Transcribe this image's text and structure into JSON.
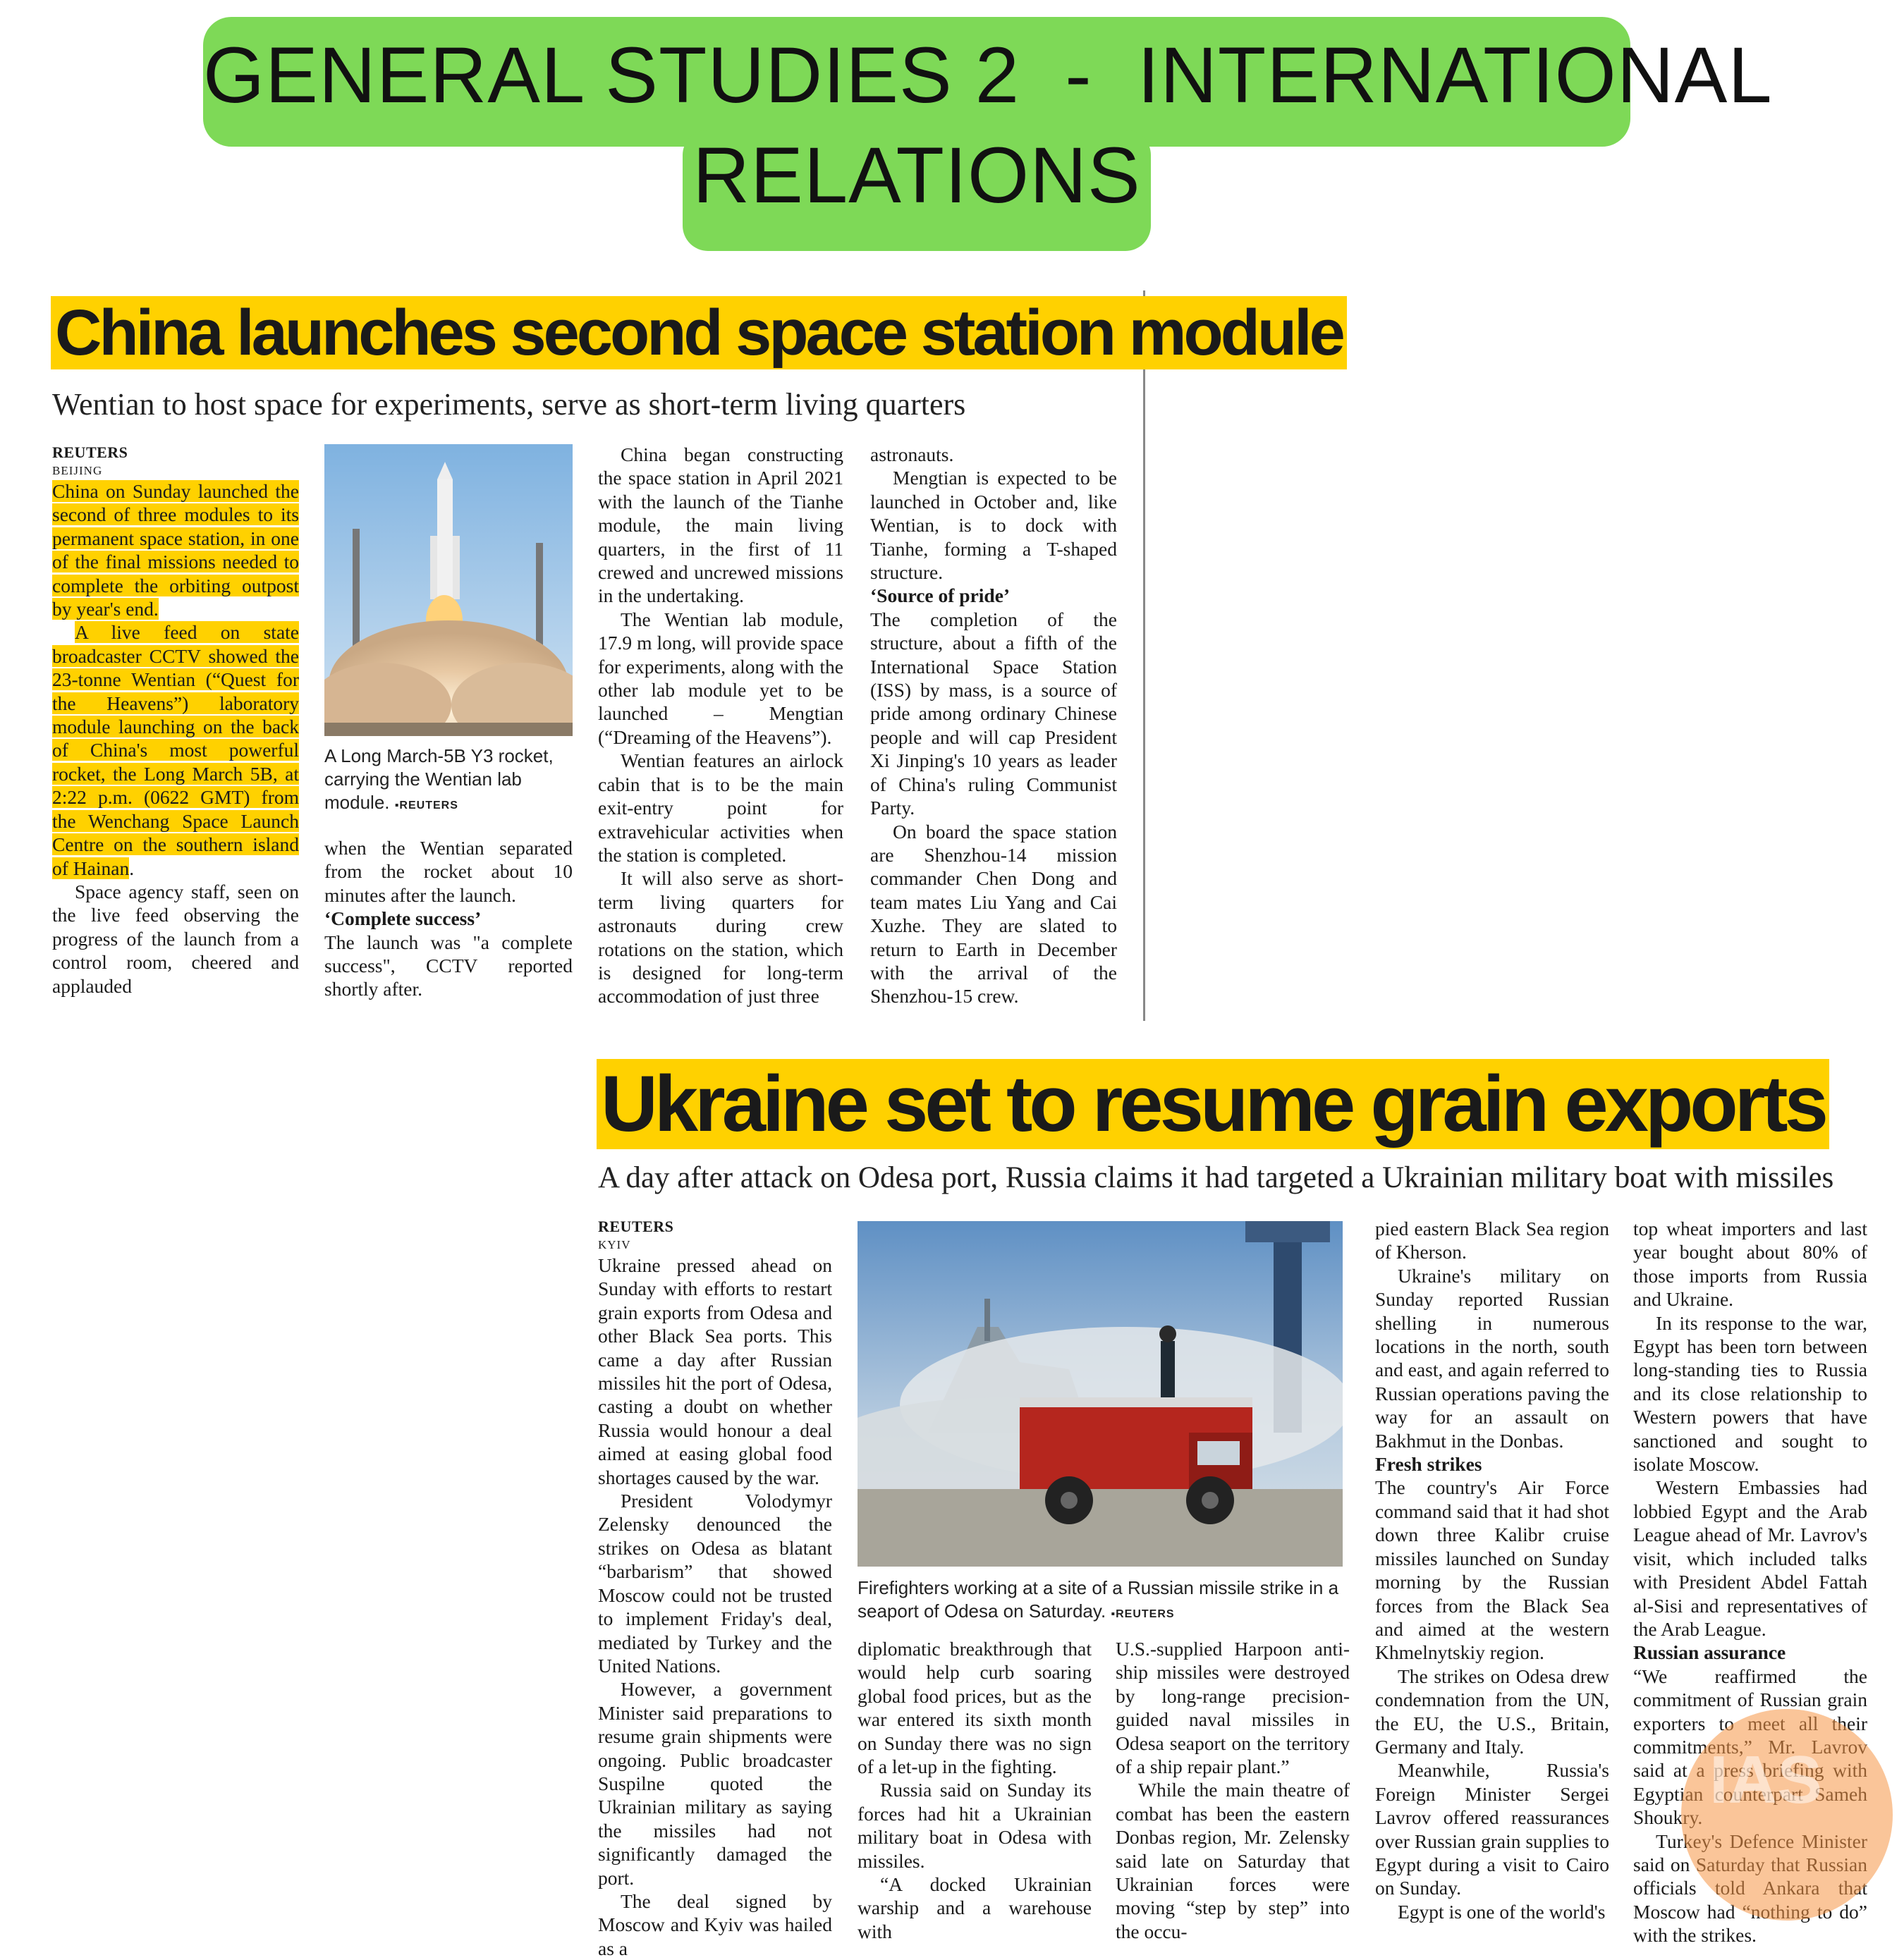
{
  "banner": {
    "line1": "GENERAL STUDIES 2  -  INTERNATIONAL",
    "line2": "RELATIONS"
  },
  "article1": {
    "headline": "China launches second space station module",
    "deck": "Wentian to host space for experiments, serve as short-term living quarters",
    "agency": "REUTERS",
    "dateline": "BEIJING",
    "col1_hl1": "China on Sunday launched the second of three modules to its permanent space station, in one of the final missions needed to complete the orbiting outpost by year's end.",
    "col1_hl2": "A live feed on state broadcaster CCTV showed the 23-tonne Wentian (“Quest for the Heavens”) laboratory module launching on the back of China's most powerful rocket, the Long March 5B, at 2:22 p.m. (0622 GMT) from the Wenchang Space Launch Centre on the southern island of Hainan",
    "col1_p3": "Space agency staff, seen on the live feed observing the progress of the launch from a control room, cheered and applauded",
    "photo_caption": "A Long March-5B Y3 rocket, carrying the Wentian lab module.",
    "photo_credit": "REUTERS",
    "col2_p1": "when the Wentian separated from the rocket about 10 minutes after the launch.",
    "sub1": "‘Complete success’",
    "col2_p2": "The launch was \"a complete success\", CCTV reported shortly after.",
    "col3_p1": "China began constructing the space station in April 2021 with the launch of the Tianhe module, the main living quarters, in the first of 11 crewed and uncrewed missions in the undertaking.",
    "col3_p2": "The Wentian lab module, 17.9 m long, will provide space for experiments, along with the other lab module yet to be launched – Mengtian (“Dreaming of the Heavens”).",
    "col3_p3": "Wentian features an airlock cabin that is to be the main exit-entry point for extravehicular activities when the station is completed.",
    "col3_p4": "It will also serve as short-term living quarters for astronauts during crew rotations on the station, which is designed for long-term accommodation of just three",
    "col4_p1": "astronauts.",
    "col4_p2": "Mengtian is expected to be launched in October and, like Wentian, is to dock with Tianhe, forming a T-shaped structure.",
    "sub2": "‘Source of pride’",
    "col4_p3": "The completion of the structure, about a fifth of the International Space Station (ISS) by mass, is a source of pride among ordinary Chinese people and will cap President Xi Jinping's 10 years as leader of China's ruling Communist Party.",
    "col4_p4": "On board the space station are Shenzhou-14 mission commander Chen Dong and team mates Liu Yang and Cai Xuzhe. They are slated to return to Earth in December with the arrival of the Shenzhou-15 crew."
  },
  "article2": {
    "headline": "Ukraine set to resume grain exports",
    "deck": "A day after attack on Odesa port, Russia claims it had targeted a Ukrainian military boat with missiles",
    "agency": "REUTERS",
    "dateline": "KYIV",
    "col1_p1": "Ukraine pressed ahead on Sunday with efforts to restart grain exports from Odesa and other Black Sea ports. This came a day after Russian missiles hit the port of Odesa, casting a doubt on whether Russia would honour a deal aimed at easing global food shortages caused by the war.",
    "col1_p2": "President Volodymyr Zelensky denounced the strikes on Odesa as blatant “barbarism” that showed Moscow could not be trusted to implement Friday's deal, mediated by Turkey and the United Nations.",
    "col1_p3": "However, a government Minister said preparations to resume grain shipments were ongoing. Public broadcaster Suspilne quoted the Ukrainian military as saying the missiles had not significantly damaged the port.",
    "col1_p4": "The deal signed by Moscow and Kyiv was hailed as a",
    "photo_caption": "Firefighters working at a site of a Russian missile strike in a seaport of Odesa on Saturday.",
    "photo_credit": "REUTERS",
    "col2_p1": "diplomatic breakthrough that would help curb soaring global food prices, but as the war entered its sixth month on Sunday there was no sign of a let-up in the fighting.",
    "col2_p2": "Russia said on Sunday its forces had hit a Ukrainian military boat in Odesa with missiles.",
    "col2_p3": "“A docked Ukrainian warship and a warehouse with",
    "col3_p1": "U.S.-supplied Harpoon anti-ship missiles were destroyed by long-range precision-guided naval missiles in Odesa seaport on the territory of a ship repair plant.”",
    "col3_p2": "While the main theatre of combat has been the eastern Donbas region, Mr. Zelensky said late on Saturday that Ukrainian forces were moving “step by step” into the occu-",
    "col4_p1": "pied eastern Black Sea region of Kherson.",
    "col4_p2": "Ukraine's military on Sunday reported Russian shelling in numerous locations in the north, south and east, and again referred to Russian operations paving the way for an assault on Bakhmut in the Donbas.",
    "sub1": "Fresh strikes",
    "col4_p3": "The country's Air Force command said that it had shot down three Kalibr cruise missiles launched on Sunday morning by the Russian forces from the Black Sea and aimed at the western Khmelnytskiy region.",
    "col4_p4": "The strikes on Odesa drew condemnation from the UN, the EU, the U.S., Britain, Germany and Italy.",
    "col4_p5": "Meanwhile, Russia's Foreign Minister Sergei Lavrov offered reassurances over Russian grain supplies to Egypt during a visit to Cairo on Sunday.",
    "col4_p6": "Egypt is one of the world's",
    "col5_p1": "top wheat importers and last year bought about 80% of those imports from Russia and Ukraine.",
    "col5_p2": "In its response to the war, Egypt has been torn between long-standing ties to Russia and its close relationship to Western powers that have sanctioned and sought to isolate Moscow.",
    "col5_p3": "Western Embassies had lobbied Egypt and the Arab League ahead of Mr. Lavrov's visit, which included talks with President Abdel Fattah al-Sisi and representatives of the Arab League.",
    "sub2": "Russian assurance",
    "col5_p4": "“We reaffirmed the commitment of Russian grain exporters to meet all their commitments,” Mr. Lavrov said at a press briefing with Egyptian counterpart Sameh Shoukry.",
    "col5_p5": "Turkey's Defence Minister said on Saturday that Russian officials told Ankara that Moscow had “nothing to do” with the strikes."
  },
  "watermark": {
    "text": "IAS"
  }
}
